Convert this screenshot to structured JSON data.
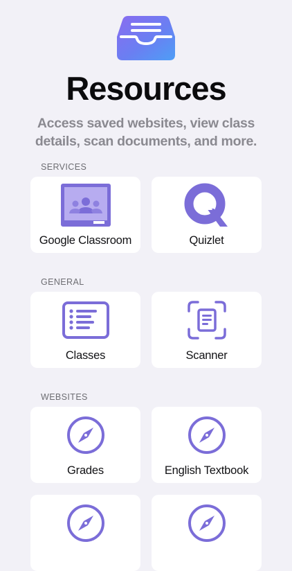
{
  "header": {
    "title": "Resources",
    "subtitle": "Access saved websites, view class details, scan documents, and more."
  },
  "sections": {
    "services": {
      "label": "SERVICES",
      "items": [
        {
          "label": "Google Classroom",
          "icon": "google-classroom-icon"
        },
        {
          "label": "Quizlet",
          "icon": "quizlet-icon"
        }
      ]
    },
    "general": {
      "label": "GENERAL",
      "items": [
        {
          "label": "Classes",
          "icon": "list-icon"
        },
        {
          "label": "Scanner",
          "icon": "document-scanner-icon"
        }
      ]
    },
    "websites": {
      "label": "WEBSITES",
      "items": [
        {
          "label": "Grades",
          "icon": "compass-icon"
        },
        {
          "label": "English Textbook",
          "icon": "compass-icon"
        },
        {
          "label": "",
          "icon": "compass-icon"
        },
        {
          "label": "",
          "icon": "compass-icon"
        }
      ]
    }
  },
  "colors": {
    "background": "#f2f1f7",
    "accent": "#7b6dd8",
    "card": "#ffffff"
  }
}
